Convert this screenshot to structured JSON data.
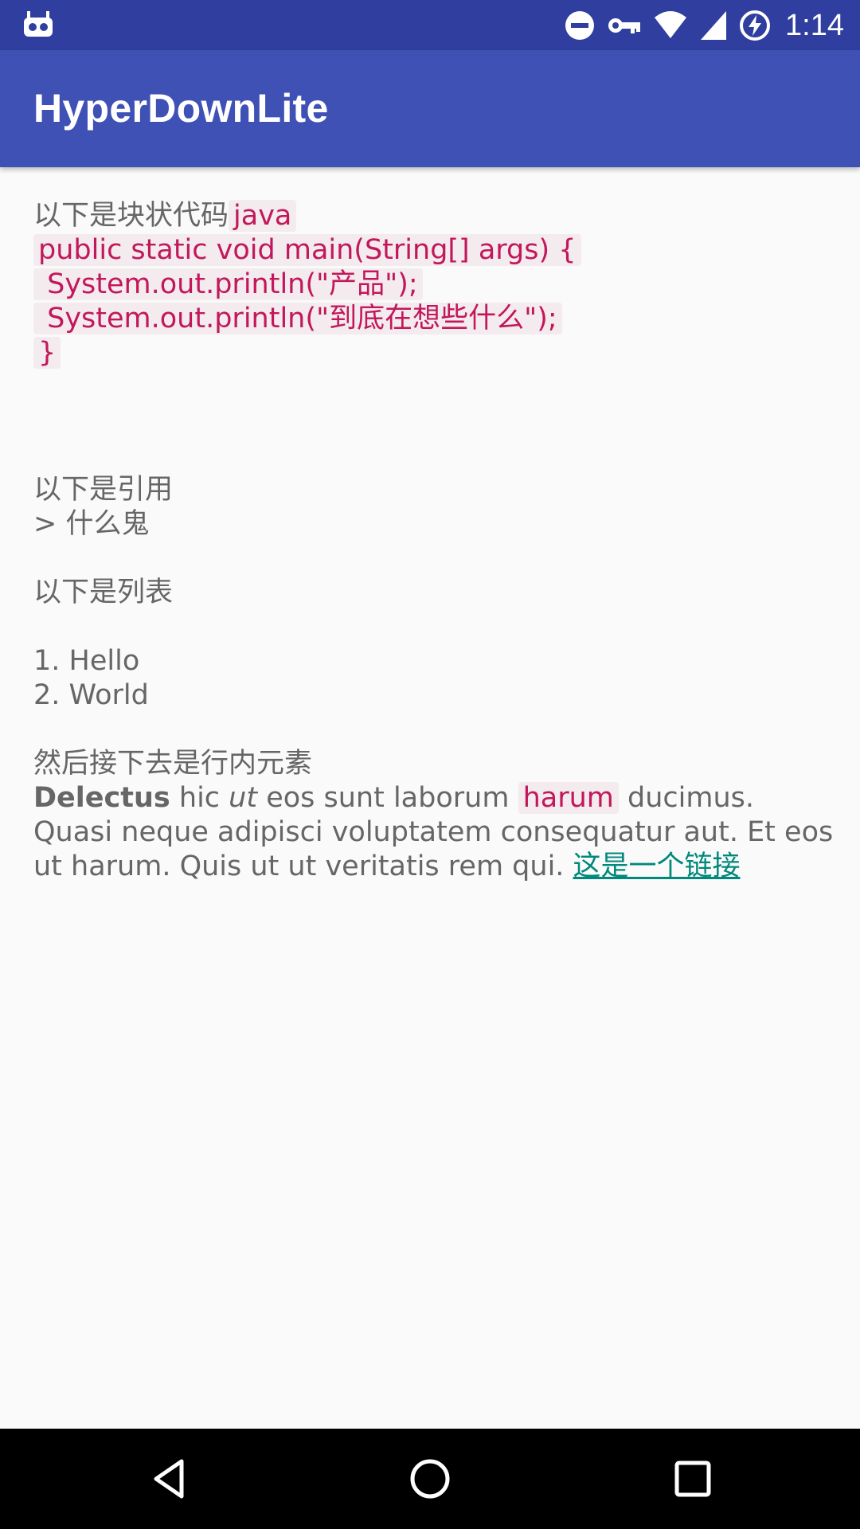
{
  "status_bar": {
    "time": "1:14",
    "icons": [
      "android-debug-icon",
      "do-not-disturb-icon",
      "vpn-key-icon",
      "wifi-icon",
      "cell-signal-icon",
      "battery-charging-icon"
    ]
  },
  "app_bar": {
    "title": "HyperDownLite"
  },
  "content": {
    "code_intro": "以下是块状代码",
    "code_lang": "java",
    "code_lines": [
      "public static void main(String[] args) {",
      " System.out.println(\"产品\");",
      " System.out.println(\"到底在想些什么\");",
      "}"
    ],
    "quote_intro": "以下是引用",
    "quote_text": "> 什么鬼",
    "list_intro": "以下是列表",
    "list_items": [
      "1. Hello",
      "2. World"
    ],
    "inline_intro": "然后接下去是行内元素",
    "inline": {
      "bold": "Delectus",
      "text_a": " hic ",
      "italic": "ut",
      "text_b": " eos sunt laborum ",
      "code": "harum",
      "text_c": " ducimus. Quasi neque adipisci voluptatem consequatur aut. Et eos ut harum. Quis ut ut veritatis rem qui. ",
      "link": "这是一个链接"
    }
  },
  "nav_bar": {
    "icons": [
      "back-icon",
      "home-icon",
      "recents-icon"
    ]
  }
}
